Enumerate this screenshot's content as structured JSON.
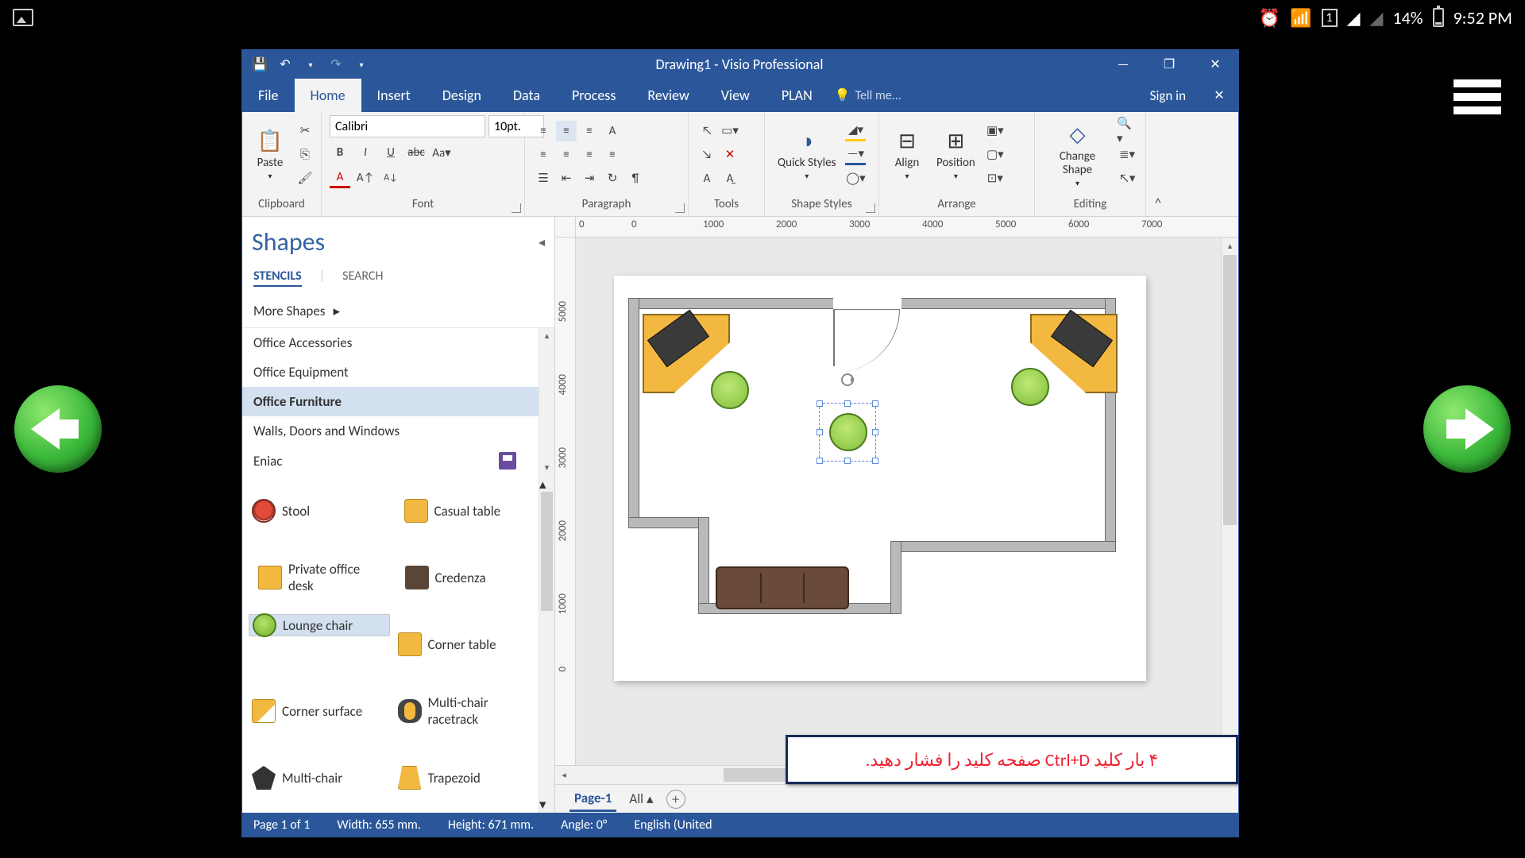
{
  "android": {
    "battery_pct": "14%",
    "time": "9:52 PM"
  },
  "title": "Drawing1 - Visio Professional",
  "tabs": {
    "file": "File",
    "home": "Home",
    "insert": "Insert",
    "design": "Design",
    "data": "Data",
    "process": "Process",
    "review": "Review",
    "view": "View",
    "plan": "PLAN",
    "tellme": "Tell me...",
    "signin": "Sign in"
  },
  "ribbon": {
    "clipboard": {
      "paste": "Paste",
      "label": "Clipboard"
    },
    "font": {
      "family": "Calibri",
      "size": "10pt.",
      "label": "Font"
    },
    "paragraph": {
      "label": "Paragraph"
    },
    "tools": {
      "label": "Tools"
    },
    "shapestyles": {
      "quick": "Quick Styles",
      "label": "Shape Styles"
    },
    "arrange": {
      "align": "Align",
      "position": "Position",
      "label": "Arrange"
    },
    "editing": {
      "change": "Change Shape",
      "label": "Editing"
    }
  },
  "shapes": {
    "title": "Shapes",
    "tab_stencils": "STENCILS",
    "tab_search": "SEARCH",
    "more": "More Shapes",
    "stencils": [
      "Office Accessories",
      "Office Equipment",
      "Office Furniture",
      "Walls, Doors and Windows",
      "Eniac"
    ],
    "items": [
      {
        "label": "Stool"
      },
      {
        "label": "Casual table"
      },
      {
        "label": "Private office desk"
      },
      {
        "label": "Credenza"
      },
      {
        "label": "Lounge chair"
      },
      {
        "label": "Corner table"
      },
      {
        "label": "Corner surface"
      },
      {
        "label": "Multi-chair racetrack"
      },
      {
        "label": "Multi-chair"
      },
      {
        "label": "Trapezoid"
      }
    ]
  },
  "ruler_h": [
    "0",
    "0",
    "1000",
    "2000",
    "3000",
    "4000",
    "5000",
    "6000",
    "7000"
  ],
  "ruler_v": [
    "5000",
    "4000",
    "3000",
    "2000",
    "1000",
    "0"
  ],
  "pagetabs": {
    "page1": "Page-1",
    "all": "All"
  },
  "instruction": "۴ بار کلید Ctrl+D صفحه کلید را فشار دهید.",
  "status": {
    "page": "Page 1 of 1",
    "width": "Width: 655 mm.",
    "height": "Height: 671 mm.",
    "angle": "Angle: 0°",
    "lang": "English (United"
  }
}
